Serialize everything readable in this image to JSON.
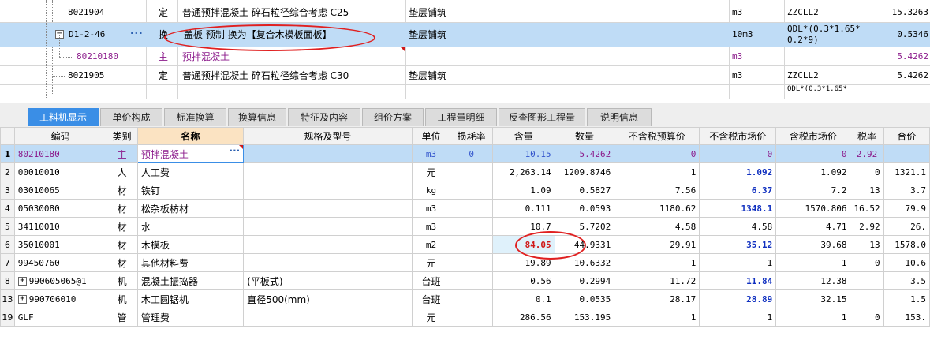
{
  "top_rows": [
    {
      "code": "8021904",
      "type": "定",
      "name": "普通预拌混凝土 碎石粒径综合考虑 C25",
      "discipline": "垫层铺筑",
      "unit": "m3",
      "expr": "ZZCLL2",
      "qty": "15.3263"
    },
    {
      "code": "D1-2-46",
      "type": "换",
      "name": "盖板 预制   换为【复合木模板面板】",
      "discipline": "垫层铺筑",
      "unit": "10m3",
      "expr": "QDL*(0.3*1.65*",
      "expr2": "0.2*9)",
      "qty": "0.5346"
    },
    {
      "code": "80210180",
      "type": "主",
      "name": "预拌混凝土",
      "discipline": "",
      "unit": "m3",
      "expr": "",
      "qty": "5.4262"
    },
    {
      "code": "8021905",
      "type": "定",
      "name": "普通预拌混凝土 碎石粒径综合考虑 C30",
      "discipline": "垫层铺筑",
      "unit": "m3",
      "expr": "ZZCLL2",
      "qty": "5.4262"
    },
    {
      "expr": "QDL*(0.3*1.65*"
    }
  ],
  "tabs": [
    {
      "label": "工料机显示"
    },
    {
      "label": "单价构成"
    },
    {
      "label": "标准换算"
    },
    {
      "label": "换算信息"
    },
    {
      "label": "特征及内容"
    },
    {
      "label": "组价方案"
    },
    {
      "label": "工程量明细"
    },
    {
      "label": "反查图形工程量"
    },
    {
      "label": "说明信息"
    }
  ],
  "grid_headers": [
    "编码",
    "类别",
    "名称",
    "规格及型号",
    "单位",
    "损耗率",
    "含量",
    "数量",
    "不含税预算价",
    "不含税市场价",
    "含税市场价",
    "税率",
    "合价"
  ],
  "grid_rows": [
    {
      "rn": "1",
      "code": "80210180",
      "cat": "主",
      "name": "预拌混凝土",
      "spec": "",
      "unit": "m3",
      "loss": "0",
      "content": "10.15",
      "qty": "5.4262",
      "pre": "0",
      "mkt": "0",
      "taxmkt": "0",
      "rate": "2.92",
      "total": ""
    },
    {
      "rn": "2",
      "code": "00010010",
      "cat": "人",
      "name": "人工费",
      "spec": "",
      "unit": "元",
      "loss": "",
      "content": "2,263.14",
      "qty": "1209.8746",
      "pre": "1",
      "mkt": "1.092",
      "taxmkt": "1.092",
      "rate": "0",
      "total": "1321.1"
    },
    {
      "rn": "3",
      "code": "03010065",
      "cat": "材",
      "name": "铁钉",
      "spec": "",
      "unit": "kg",
      "loss": "",
      "content": "1.09",
      "qty": "0.5827",
      "pre": "7.56",
      "mkt": "6.37",
      "taxmkt": "7.2",
      "rate": "13",
      "total": "3.7"
    },
    {
      "rn": "4",
      "code": "05030080",
      "cat": "材",
      "name": "松杂板枋材",
      "spec": "",
      "unit": "m3",
      "loss": "",
      "content": "0.111",
      "qty": "0.0593",
      "pre": "1180.62",
      "mkt": "1348.1",
      "taxmkt": "1570.806",
      "rate": "16.52",
      "total": "79.9"
    },
    {
      "rn": "5",
      "code": "34110010",
      "cat": "材",
      "name": "水",
      "spec": "",
      "unit": "m3",
      "loss": "",
      "content": "10.7",
      "qty": "5.7202",
      "pre": "4.58",
      "mkt": "4.58",
      "taxmkt": "4.71",
      "rate": "2.92",
      "total": "26."
    },
    {
      "rn": "6",
      "code": "35010001",
      "cat": "材",
      "name": "木模板",
      "spec": "",
      "unit": "m2",
      "loss": "",
      "content": "84.05",
      "qty": "44.9331",
      "pre": "29.91",
      "mkt": "35.12",
      "taxmkt": "39.68",
      "rate": "13",
      "total": "1578.0"
    },
    {
      "rn": "7",
      "code": "99450760",
      "cat": "材",
      "name": "其他材料费",
      "spec": "",
      "unit": "元",
      "loss": "",
      "content": "19.89",
      "qty": "10.6332",
      "pre": "1",
      "mkt": "1",
      "taxmkt": "1",
      "rate": "0",
      "total": "10.6"
    },
    {
      "rn": "8",
      "code": "990605065@1",
      "cat": "机",
      "name": "混凝土振捣器",
      "spec": "(平板式)",
      "unit": "台班",
      "loss": "",
      "content": "0.56",
      "qty": "0.2994",
      "pre": "11.72",
      "mkt": "11.84",
      "taxmkt": "12.38",
      "rate": "",
      "total": "3.5"
    },
    {
      "rn": "13",
      "code": "990706010",
      "cat": "机",
      "name": "木工圆锯机",
      "spec": "直径500(mm)",
      "unit": "台班",
      "loss": "",
      "content": "0.1",
      "qty": "0.0535",
      "pre": "28.17",
      "mkt": "28.89",
      "taxmkt": "32.15",
      "rate": "",
      "total": "1.5"
    },
    {
      "rn": "19",
      "code": "GLF",
      "cat": "管",
      "name": "管理费",
      "spec": "",
      "unit": "元",
      "loss": "",
      "content": "286.56",
      "qty": "153.195",
      "pre": "1",
      "mkt": "1",
      "taxmkt": "1",
      "rate": "0",
      "total": "153."
    }
  ],
  "colors": {
    "accent": "#3a8ee6",
    "selected": "#bfdcf6",
    "annotation": "#e02020",
    "main_material": "#8b1a8b"
  }
}
